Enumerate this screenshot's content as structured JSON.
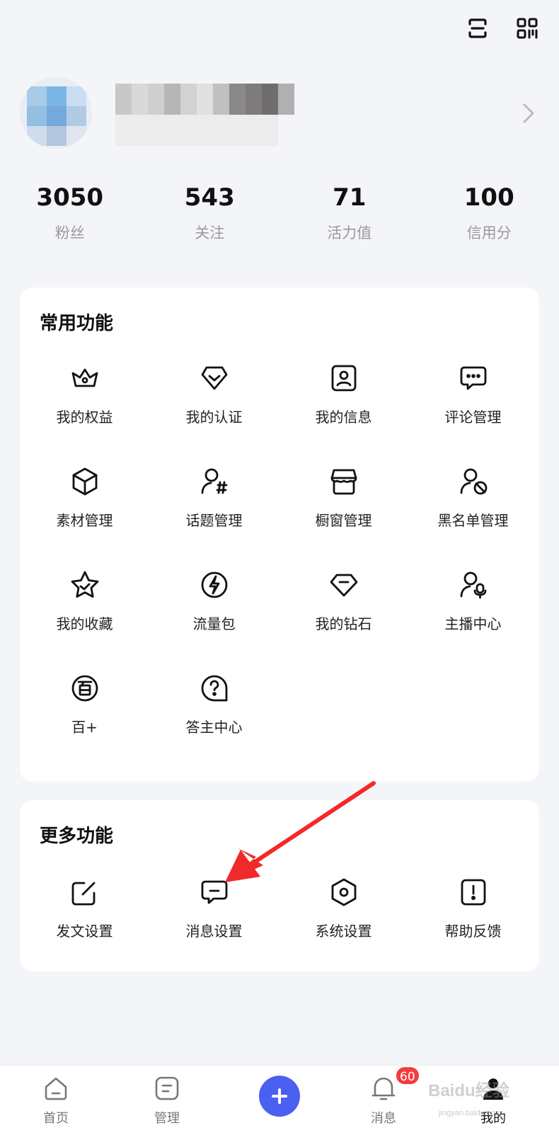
{
  "profile": {
    "stats": [
      {
        "value": "3050",
        "label": "粉丝"
      },
      {
        "value": "543",
        "label": "关注"
      },
      {
        "value": "71",
        "label": "活力值"
      },
      {
        "value": "100",
        "label": "信用分"
      }
    ]
  },
  "common": {
    "title": "常用功能",
    "items": [
      {
        "label": "我的权益",
        "icon": "crown-icon"
      },
      {
        "label": "我的认证",
        "icon": "verify-shield-icon"
      },
      {
        "label": "我的信息",
        "icon": "profile-card-icon"
      },
      {
        "label": "评论管理",
        "icon": "comment-icon"
      },
      {
        "label": "素材管理",
        "icon": "cube-icon"
      },
      {
        "label": "话题管理",
        "icon": "user-hashtag-icon"
      },
      {
        "label": "橱窗管理",
        "icon": "storefront-icon"
      },
      {
        "label": "黑名单管理",
        "icon": "user-block-icon"
      },
      {
        "label": "我的收藏",
        "icon": "star-icon"
      },
      {
        "label": "流量包",
        "icon": "lightning-icon"
      },
      {
        "label": "我的钻石",
        "icon": "diamond-icon"
      },
      {
        "label": "主播中心",
        "icon": "user-mic-icon"
      },
      {
        "label": "百+",
        "icon": "bai-plus-icon"
      },
      {
        "label": "答主中心",
        "icon": "question-bubble-icon"
      }
    ]
  },
  "more": {
    "title": "更多功能",
    "items": [
      {
        "label": "发文设置",
        "icon": "edit-icon"
      },
      {
        "label": "消息设置",
        "icon": "message-icon"
      },
      {
        "label": "系统设置",
        "icon": "hex-settings-icon"
      },
      {
        "label": "帮助反馈",
        "icon": "feedback-icon"
      }
    ]
  },
  "nav": {
    "home": "首页",
    "manage": "管理",
    "messages": "消息",
    "messages_badge": "60",
    "mine": "我的"
  },
  "watermark": {
    "logo": "Baidu经验",
    "url": "jingyan.baidu.com"
  },
  "colors": {
    "accent": "#4b5ff0",
    "badge": "#f23d3d",
    "annotation_arrow": "#f02a2a"
  }
}
